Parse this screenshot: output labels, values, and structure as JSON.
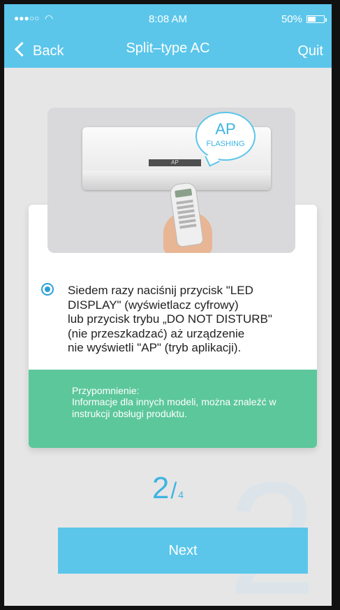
{
  "status_bar": {
    "signal_dots": "●●●○○",
    "time": "8:08 AM",
    "battery": "50%",
    "battery_level": 0.5
  },
  "nav": {
    "back_label": "Back",
    "title": "Split–type AC",
    "quit_label": "Quit"
  },
  "illustration": {
    "bubble_main": "AP",
    "bubble_sub": "FLASHING",
    "display_text": "AP"
  },
  "instruction": "Siedem razy naciśnij przycisk \"LED\nDISPLAY\" (wyświetlacz cyfrowy)\nlub przycisk trybu „DO NOT DISTURB\"\n(nie przeszkadzać) aż urządzenie\nnie wyświetli \"AP\" (tryb aplikacji).",
  "reminder": {
    "title": "Przypomnienie:",
    "body": "Informacje dla innych modeli, można znaleźć w instrukcji obsługi produktu."
  },
  "step": {
    "current": "2",
    "separator": "/",
    "total": "4"
  },
  "next_label": "Next",
  "colors": {
    "header": "#5bc6ea",
    "reminder": "#5cc79b",
    "accent": "#3eb4e2"
  }
}
